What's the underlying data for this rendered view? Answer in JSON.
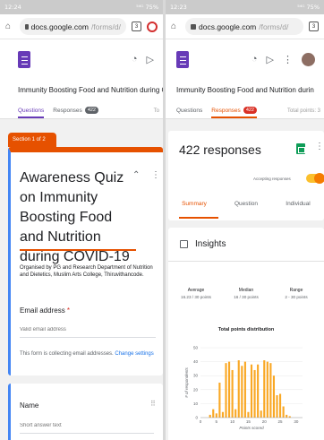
{
  "left": {
    "status_time": "12:24",
    "status_right": "⁵⁴ᴳ 75%",
    "url_domain": "docs.google.com",
    "url_path": "/forms/d/",
    "tab_count": "3",
    "form_title": "Immunity Boosting Food and Nutrition during C",
    "tabs": [
      {
        "label": "Questions"
      },
      {
        "label": "Responses",
        "badge": "422"
      }
    ],
    "tab_tail": "To",
    "section_tag": "Section 1 of 2",
    "quiz_title": "Awareness Quiz on Immunity Boosting Food and Nutrition during COVID-19",
    "description": "Organised by PG and Research Department of Nutrition and Dietetics, Muslim Arts College, Thiruvithancode.",
    "email_label": "Email address",
    "email_required": "*",
    "email_placeholder": "Valid email address",
    "collect_text": "This form is collecting email addresses.",
    "collect_link": "Change settings",
    "name_label": "Name",
    "name_placeholder": "Short answer text"
  },
  "right": {
    "status_time": "12:23",
    "status_right": "⁵⁴ᴳ 75%",
    "url_domain": "docs.google.com",
    "url_path": "/forms/d/",
    "tab_count": "3",
    "form_title": "Immunity Boosting Food and Nutrition durin",
    "tabs": [
      {
        "label": "Questions"
      },
      {
        "label": "Responses",
        "badge": "422"
      }
    ],
    "tab_tail": "Total points: 3",
    "responses_count": "422 responses",
    "accepting": "Accepting responses",
    "subtabs": [
      "Summary",
      "Question",
      "Individual"
    ],
    "insights_title": "Insights",
    "stats": [
      {
        "label": "Average",
        "value": "16.23 / 30 points"
      },
      {
        "label": "Median",
        "value": "16 / 30 points"
      },
      {
        "label": "Range",
        "value": "2 - 30 points"
      }
    ],
    "dist_title": "Total points distribution"
  },
  "colors": {
    "accent": "#e65100",
    "purple": "#673ab7",
    "bar": "#f9a825",
    "blue": "#4285f4"
  },
  "chart_data": {
    "type": "bar",
    "title": "Total points distribution",
    "xlabel": "Points scored",
    "ylabel": "# of respondents",
    "x": [
      3,
      4,
      5,
      6,
      7,
      8,
      9,
      10,
      11,
      12,
      13,
      14,
      15,
      16,
      17,
      18,
      19,
      20,
      21,
      22,
      23,
      24,
      25,
      26,
      27,
      28,
      29,
      30
    ],
    "values": [
      2,
      6,
      3,
      25,
      4,
      39,
      40,
      34,
      6,
      41,
      37,
      40,
      4,
      38,
      34,
      38,
      5,
      41,
      40,
      39,
      30,
      16,
      17,
      8,
      2,
      1,
      0,
      0
    ],
    "xticks": [
      0,
      5,
      10,
      15,
      20,
      25,
      30
    ],
    "yticks": [
      0,
      10,
      20,
      30,
      40,
      50
    ],
    "xlim": [
      0,
      32
    ],
    "ylim": [
      0,
      50
    ]
  }
}
